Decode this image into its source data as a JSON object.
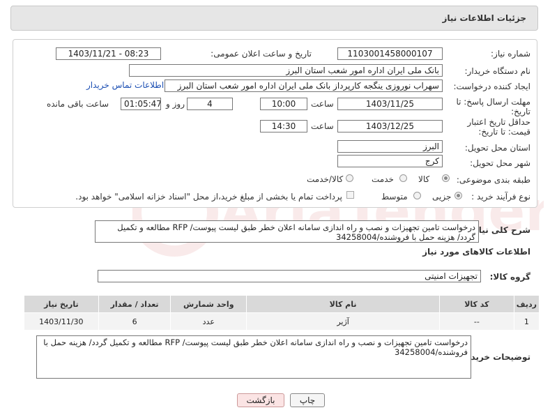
{
  "header": {
    "title": "جزئیات اطلاعات نیاز"
  },
  "labels": {
    "need_number": "شماره نیاز:",
    "announce_datetime": "تاریخ و ساعت اعلان عمومی:",
    "buyer_org": "نام دستگاه خریدار:",
    "requester": "ایجاد کننده درخواست:",
    "reply_deadline": "مهلت ارسال پاسخ: تا تاریخ:",
    "price_validity": "حداقل تاریخ اعتبار قیمت: تا تاریخ:",
    "province": "استان محل تحویل:",
    "city": "شهر محل تحویل:",
    "category": "طبقه بندی موضوعی:",
    "process_type": "نوع فرآیند خرید :",
    "time_word": "ساعت",
    "time_word2": "ساعت",
    "day_word": "روز و",
    "remaining_word": "ساعت باقی مانده",
    "general_desc": "شرح کلی نیاز:",
    "goods_info": "اطلاعات کالاهای مورد نیاز",
    "goods_group": "گروه کالا:",
    "buyer_notes": "توضیحات خریدار:"
  },
  "values": {
    "need_number": "1103001458000107",
    "announce_datetime": "1403/11/21 - 08:23",
    "buyer_org": "بانک ملی ایران اداره امور شعب استان البرز",
    "requester": "سهراب نوروزی ینگجه کارپرداز بانک ملی ایران اداره امور شعب استان البرز",
    "contact_link": "اطلاعات تماس خریدار",
    "reply_date": "1403/11/25",
    "reply_time": "10:00",
    "days": "4",
    "remaining_time": "01:05:47",
    "validity_date": "1403/12/25",
    "validity_time": "14:30",
    "province": "البرز",
    "city": "کرج",
    "goods_group": "تجهیزات امنیتی",
    "general_desc": "درخواست تامین تجهیزات و نصب و راه اندازی سامانه اعلان خطر طبق لیست پیوست/ RFP مطالعه و تکمیل گردد/ هزینه حمل با فروشنده/34258004",
    "buyer_notes": "درخواست تامین تجهیزات و نصب و راه اندازی سامانه اعلان خطر طبق لیست پیوست/ RFP مطالعه و تکمیل گردد/ هزینه حمل با فروشنده/34258004"
  },
  "category_options": [
    {
      "label": "کالا",
      "selected": true
    },
    {
      "label": "خدمت",
      "selected": false
    },
    {
      "label": "کالا/خدمت",
      "selected": false
    }
  ],
  "process_options": [
    {
      "label": "جزیی",
      "selected": true
    },
    {
      "label": "متوسط",
      "selected": false
    }
  ],
  "payment_note": "پرداخت تمام یا بخشی از مبلغ خرید،از محل \"اسناد خزانه اسلامی\" خواهد بود.",
  "table": {
    "headers": [
      "ردیف",
      "کد کالا",
      "نام کالا",
      "واحد شمارش",
      "تعداد / مقدار",
      "تاریخ نیاز"
    ],
    "rows": [
      [
        "1",
        "--",
        "آژیر",
        "عدد",
        "6",
        "1403/11/30"
      ]
    ]
  },
  "buttons": {
    "back": "بازگشت",
    "print": "چاپ"
  },
  "watermark": {
    "text": "AriaTender.neT"
  }
}
